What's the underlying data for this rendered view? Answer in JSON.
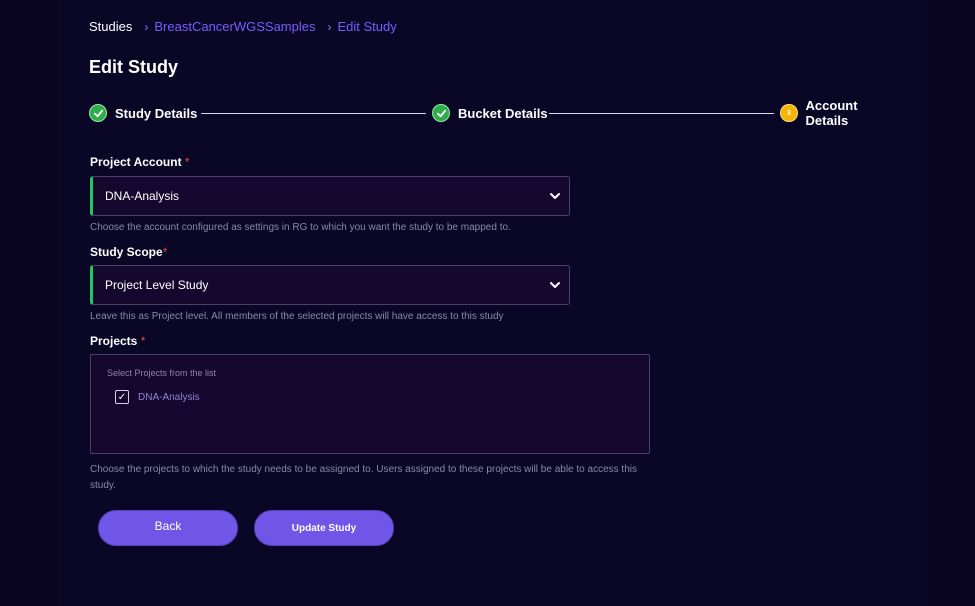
{
  "breadcrumb": {
    "root": "Studies",
    "separator": "›",
    "study": "BreastCancerWGSSamples",
    "current": "Edit Study"
  },
  "page": {
    "title": "Edit Study"
  },
  "stepper": {
    "steps": [
      {
        "label": "Study Details",
        "status": "complete",
        "icon": "check-icon"
      },
      {
        "label": "Bucket Details",
        "status": "complete",
        "icon": "check-icon"
      },
      {
        "label": "Account Details",
        "status": "current",
        "number": "3"
      }
    ]
  },
  "form": {
    "project_account": {
      "label": "Project Account",
      "required_mark": "*",
      "value": "DNA-Analysis",
      "help": "Choose the account configured as settings in RG to which you want the study to be mapped to."
    },
    "study_scope": {
      "label": "Study Scope",
      "required_mark": "*",
      "value": "Project Level Study",
      "help": "Leave this as Project level. All members of the selected projects will have access to this study"
    },
    "projects": {
      "label": "Projects",
      "required_mark": "*",
      "hint": "Select Projects from the list",
      "items": [
        {
          "label": "DNA-Analysis",
          "checked": true,
          "mark": "✓"
        }
      ],
      "help": "Choose the projects to which the study needs to be assigned to. Users assigned to these projects will be able to access this study."
    }
  },
  "buttons": {
    "back": "Back",
    "update": "Update Study"
  },
  "colors": {
    "background": "#090521",
    "accent": "#6f56e6",
    "link": "#7a5cff",
    "success": "#2dae4b",
    "current_step": "#f5b400",
    "required": "#e74c3c"
  }
}
